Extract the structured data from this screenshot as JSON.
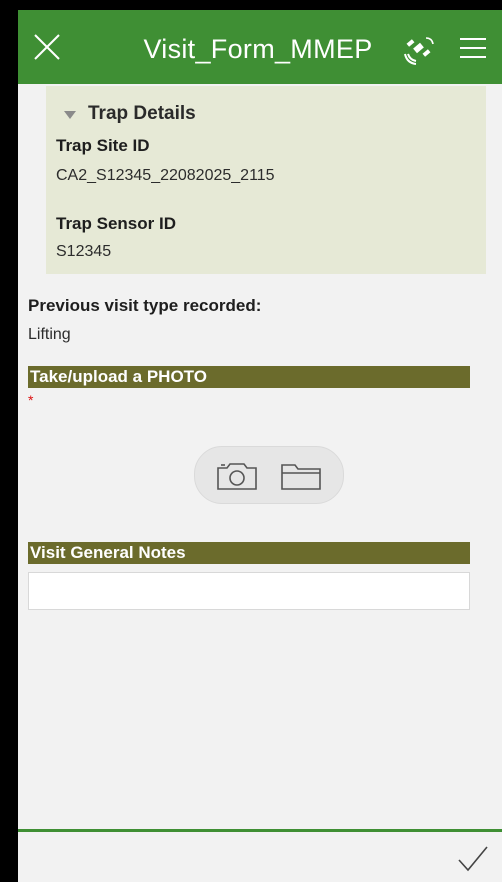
{
  "header": {
    "title": "Visit_Form_MMEP",
    "close_icon": "close-icon",
    "gps_icon": "satellite-gps-icon",
    "menu_icon": "hamburger-menu-icon",
    "color": "#3f8f34"
  },
  "trap_details": {
    "section_title": "Trap Details",
    "site_id_label": "Trap Site ID",
    "site_id_value": "CA2_S12345_22082025_2115",
    "sensor_id_label": "Trap Sensor ID",
    "sensor_id_value": "S12345",
    "background": "#e6e9d6"
  },
  "previous_visit": {
    "label": "Previous visit type recorded:",
    "value": "Lifting"
  },
  "photo": {
    "label": "Take/upload a PHOTO",
    "required_mark": "*",
    "camera_icon": "camera-icon",
    "folder_icon": "folder-icon"
  },
  "notes": {
    "label": "Visit General Notes",
    "value": "",
    "placeholder": ""
  },
  "footer": {
    "submit_icon": "checkmark-icon"
  },
  "colors": {
    "section_bar": "#6b6b2c",
    "required": "#dd1111",
    "accent": "#3f8f34"
  }
}
